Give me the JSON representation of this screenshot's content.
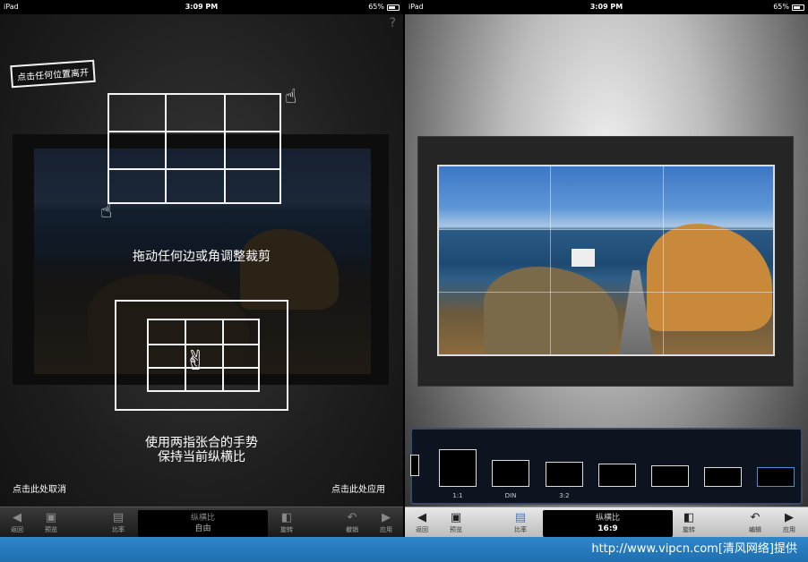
{
  "status_bar": {
    "carrier": "iPad",
    "time": "3:09 PM",
    "battery": "65%"
  },
  "help_icon": "?",
  "left": {
    "exit_hint": "点击任何位置离开",
    "drag_hint": "拖动任何边或角调整裁剪",
    "pinch_hint_line1": "使用两指张合的手势",
    "pinch_hint_line2": "保持当前纵横比",
    "cancel_hint": "点击此处取消",
    "apply_hint": "点击此处应用",
    "toolbar": {
      "back": "返回",
      "preview": "预览",
      "ratio": "比率",
      "aspect_title": "纵横比",
      "aspect_value": "自由",
      "rotate": "旋转",
      "undo": "撤销",
      "apply": "应用"
    }
  },
  "right": {
    "ratios": [
      {
        "label": "1:1"
      },
      {
        "label": "DIN"
      },
      {
        "label": "3:2"
      },
      {
        "label": ""
      },
      {
        "label": ""
      },
      {
        "label": ""
      },
      {
        "label": ""
      }
    ],
    "toolbar": {
      "back": "返回",
      "preview": "预览",
      "ratio": "比率",
      "aspect_title": "纵横比",
      "aspect_value": "16:9",
      "rotate": "旋转",
      "edit": "编辑",
      "apply": "应用"
    }
  },
  "watermark": "http://www.vipcn.com[清风网络]提供",
  "colors": {
    "watermark_bar": "#2f86c9",
    "selected_ratio": "#4a90d9"
  }
}
